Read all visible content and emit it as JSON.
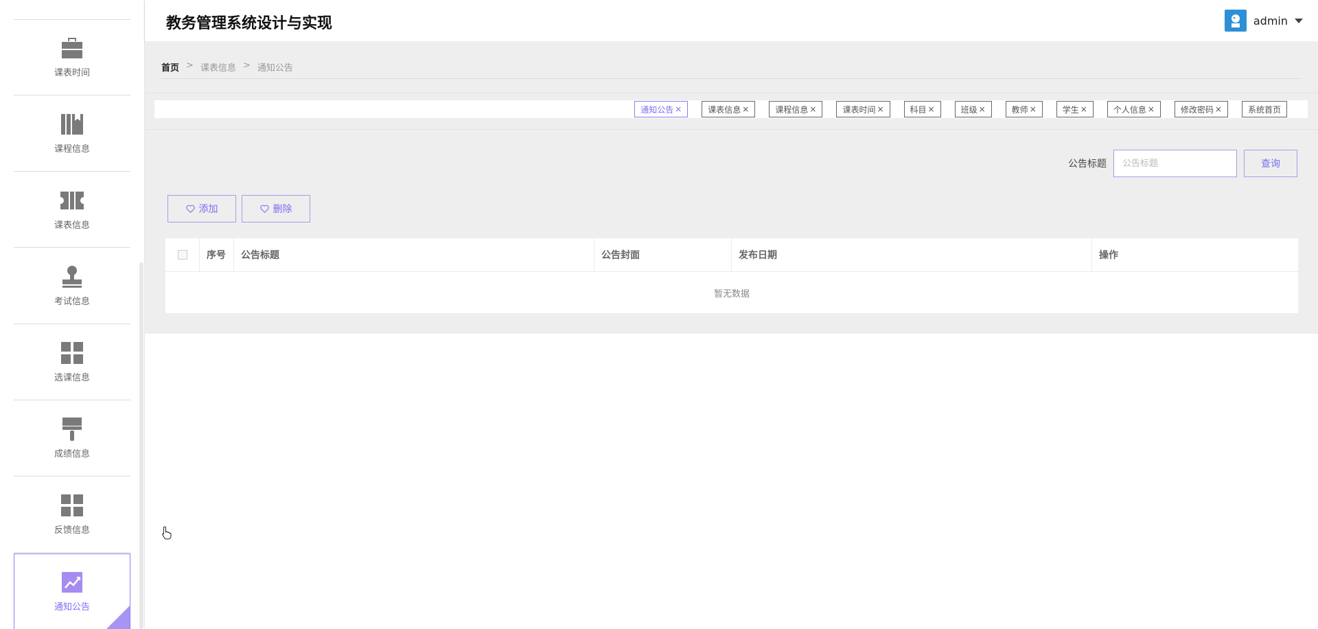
{
  "header": {
    "title": "教务管理系统设计与实现",
    "username": "admin"
  },
  "sidebar": {
    "items": [
      {
        "label": "课表时间",
        "icon": "briefcase-icon"
      },
      {
        "label": "课程信息",
        "icon": "books-icon"
      },
      {
        "label": "课表信息",
        "icon": "ticket-icon"
      },
      {
        "label": "考试信息",
        "icon": "stamp-icon"
      },
      {
        "label": "选课信息",
        "icon": "grid-icon"
      },
      {
        "label": "成绩信息",
        "icon": "brush-icon"
      },
      {
        "label": "反馈信息",
        "icon": "grid-icon"
      },
      {
        "label": "通知公告",
        "icon": "chart-icon",
        "active": true
      }
    ]
  },
  "breadcrumb": {
    "home": "首页",
    "sep1": ">",
    "level1": "课表信息",
    "sep2": ">",
    "level2": "通知公告"
  },
  "tags": [
    {
      "label": "通知公告",
      "close": "×",
      "active": true
    },
    {
      "label": "课表信息",
      "close": "×"
    },
    {
      "label": "课程信息",
      "close": "×"
    },
    {
      "label": "课表时间",
      "close": "×"
    },
    {
      "label": "科目",
      "close": "×"
    },
    {
      "label": "班级",
      "close": "×"
    },
    {
      "label": "教师",
      "close": "×"
    },
    {
      "label": "学生",
      "close": "×"
    },
    {
      "label": "个人信息",
      "close": "×"
    },
    {
      "label": "修改密码",
      "close": "×"
    },
    {
      "label": "系统首页",
      "close": ""
    }
  ],
  "search": {
    "label": "公告标题",
    "placeholder": "公告标题",
    "button": "查询"
  },
  "actions": {
    "add": "添加",
    "delete": "删除"
  },
  "table": {
    "columns": [
      "序号",
      "公告标题",
      "公告封面",
      "发布日期",
      "操作"
    ],
    "empty": "暂无数据"
  },
  "colors": {
    "accent": "#7b6ff0",
    "border_accent": "#a89ce8",
    "main_bg": "#eeeeee"
  }
}
